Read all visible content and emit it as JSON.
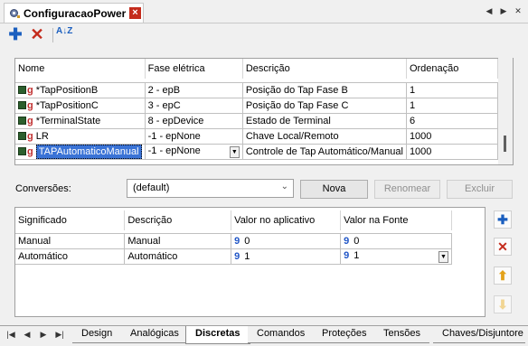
{
  "window": {
    "tab_title": "ConfiguracaoPower",
    "close_glyph": "×"
  },
  "nav": {
    "left": "◀",
    "right": "▶",
    "close": "✕"
  },
  "toolbar": {
    "add_glyph": "✚",
    "delete_glyph": "✕",
    "sort_glyph": "A↓Z"
  },
  "grid1": {
    "headers": [
      "Nome",
      "Fase elétrica",
      "Descrição",
      "Ordenação"
    ],
    "rows": [
      {
        "name": "*TapPositionB",
        "phase": "2 - epB",
        "desc": "Posição do Tap Fase B",
        "order": "1"
      },
      {
        "name": "*TapPositionC",
        "phase": "3 - epC",
        "desc": "Posição do Tap Fase C",
        "order": "1"
      },
      {
        "name": "*TerminalState",
        "phase": "8 - epDevice",
        "desc": "Estado de Terminal",
        "order": "6"
      },
      {
        "name": "LR",
        "phase": "-1 - epNone",
        "desc": "Chave Local/Remoto",
        "order": "1000"
      },
      {
        "name": "TAPAutomaticoManual",
        "phase": "-1 - epNone",
        "desc": "Controle de Tap Automático/Manual",
        "order": "1000"
      }
    ],
    "icon_g": "g",
    "dropdown_glyph": "▼"
  },
  "conversions": {
    "label": "Conversões:",
    "selected": "(default)",
    "new_label": "Nova",
    "rename_label": "Renomear",
    "delete_label": "Excluir"
  },
  "grid2": {
    "headers": [
      "Significado",
      "Descrição",
      "Valor no aplicativo",
      "Valor na Fonte"
    ],
    "rows": [
      {
        "meaning": "Manual",
        "desc": "Manual",
        "app": "0",
        "src": "0"
      },
      {
        "meaning": "Automático",
        "desc": "Automático",
        "app": "1",
        "src": "1"
      }
    ],
    "icon_9": "9"
  },
  "side_buttons": {
    "add": "✚",
    "delete": "✕",
    "up": "⬆",
    "down": "⬇"
  },
  "tabs": {
    "nav": [
      "|◀",
      "◀",
      "▶",
      "▶|"
    ],
    "items": [
      "Design",
      "Analógicas",
      "Discretas",
      "Comandos",
      "Proteções",
      "Tensões",
      "Chaves/Disjuntore"
    ],
    "active": "Discretas"
  },
  "colors": {
    "accent_blue": "#1b5fbf",
    "delete_red": "#c42b1c",
    "selection": "#3a73d6",
    "tab_close": "#c42b1c"
  }
}
